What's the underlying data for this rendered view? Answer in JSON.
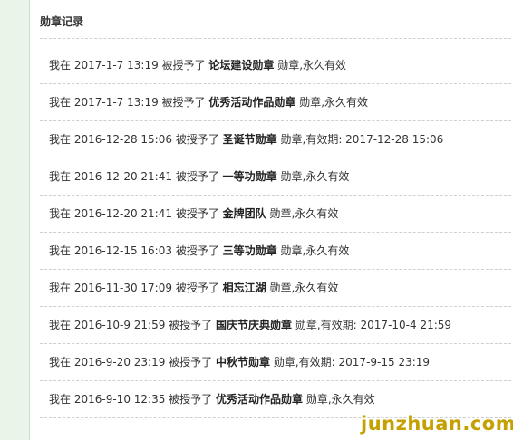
{
  "section": {
    "title": "勋章记录"
  },
  "records": [
    {
      "prefix": "我在",
      "time": "2017-1-7 13:19",
      "verb": "被授予了",
      "medal": "论坛建设勋章",
      "suffix": "勋章,永久有效"
    },
    {
      "prefix": "我在",
      "time": "2017-1-7 13:19",
      "verb": "被授予了",
      "medal": "优秀活动作品勋章",
      "suffix": "勋章,永久有效"
    },
    {
      "prefix": "我在",
      "time": "2016-12-28 15:06",
      "verb": "被授予了",
      "medal": "圣诞节勋章",
      "suffix": "勋章,有效期: 2017-12-28 15:06"
    },
    {
      "prefix": "我在",
      "time": "2016-12-20 21:41",
      "verb": "被授予了",
      "medal": "一等功勋章",
      "suffix": "勋章,永久有效"
    },
    {
      "prefix": "我在",
      "time": "2016-12-20 21:41",
      "verb": "被授予了",
      "medal": "金牌团队",
      "suffix": "勋章,永久有效"
    },
    {
      "prefix": "我在",
      "time": "2016-12-15 16:03",
      "verb": "被授予了",
      "medal": "三等功勋章",
      "suffix": "勋章,永久有效"
    },
    {
      "prefix": "我在",
      "time": "2016-11-30 17:09",
      "verb": "被授予了",
      "medal": "相忘江湖",
      "suffix": "勋章,永久有效"
    },
    {
      "prefix": "我在",
      "time": "2016-10-9 21:59",
      "verb": "被授予了",
      "medal": "国庆节庆典勋章",
      "suffix": "勋章,有效期: 2017-10-4 21:59"
    },
    {
      "prefix": "我在",
      "time": "2016-9-20 23:19",
      "verb": "被授予了",
      "medal": "中秋节勋章",
      "suffix": "勋章,有效期: 2017-9-15 23:19"
    },
    {
      "prefix": "我在",
      "time": "2016-9-10 12:35",
      "verb": "被授予了",
      "medal": "优秀活动作品勋章",
      "suffix": "勋章,永久有效"
    }
  ],
  "watermark": {
    "text": "junzhuan.com"
  },
  "colors": {
    "left_strip": "#e9f5e9",
    "divider": "#cfcfcf",
    "watermark": "#c4a000"
  }
}
